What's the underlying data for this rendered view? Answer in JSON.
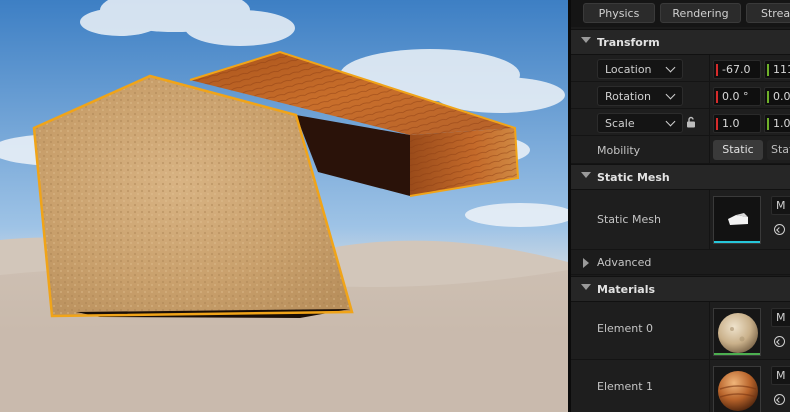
{
  "tabs": [
    "Physics",
    "Rendering",
    "Streaming"
  ],
  "transform": {
    "title": "Transform",
    "location": {
      "label": "Location",
      "x": "-67.0",
      "y": "111"
    },
    "rotation": {
      "label": "Rotation",
      "x": "0.0 °",
      "y": "0.0"
    },
    "scale": {
      "label": "Scale",
      "x": "1.0",
      "y": "1.0"
    },
    "mobility": {
      "label": "Mobility",
      "options": [
        "Static",
        "Stationary"
      ]
    }
  },
  "static_mesh": {
    "title": "Static Mesh",
    "row_label": "Static Mesh",
    "asset_initial": "M"
  },
  "advanced": {
    "label": "Advanced"
  },
  "materials": {
    "title": "Materials",
    "elements": [
      {
        "label": "Element 0",
        "asset_initial": "M"
      },
      {
        "label": "Element 1",
        "asset_initial": "M"
      }
    ]
  },
  "colors": {
    "selection_outline": "#f0a419",
    "axis_x": "#d62b2b",
    "axis_y": "#6fb12a",
    "mesh_underline": "#26c6da",
    "material_underline": "#4caf50"
  },
  "icons": [
    "lock-icon",
    "reset-arrow-icon",
    "chevron-down-icon",
    "collapse-arrow-icon"
  ]
}
